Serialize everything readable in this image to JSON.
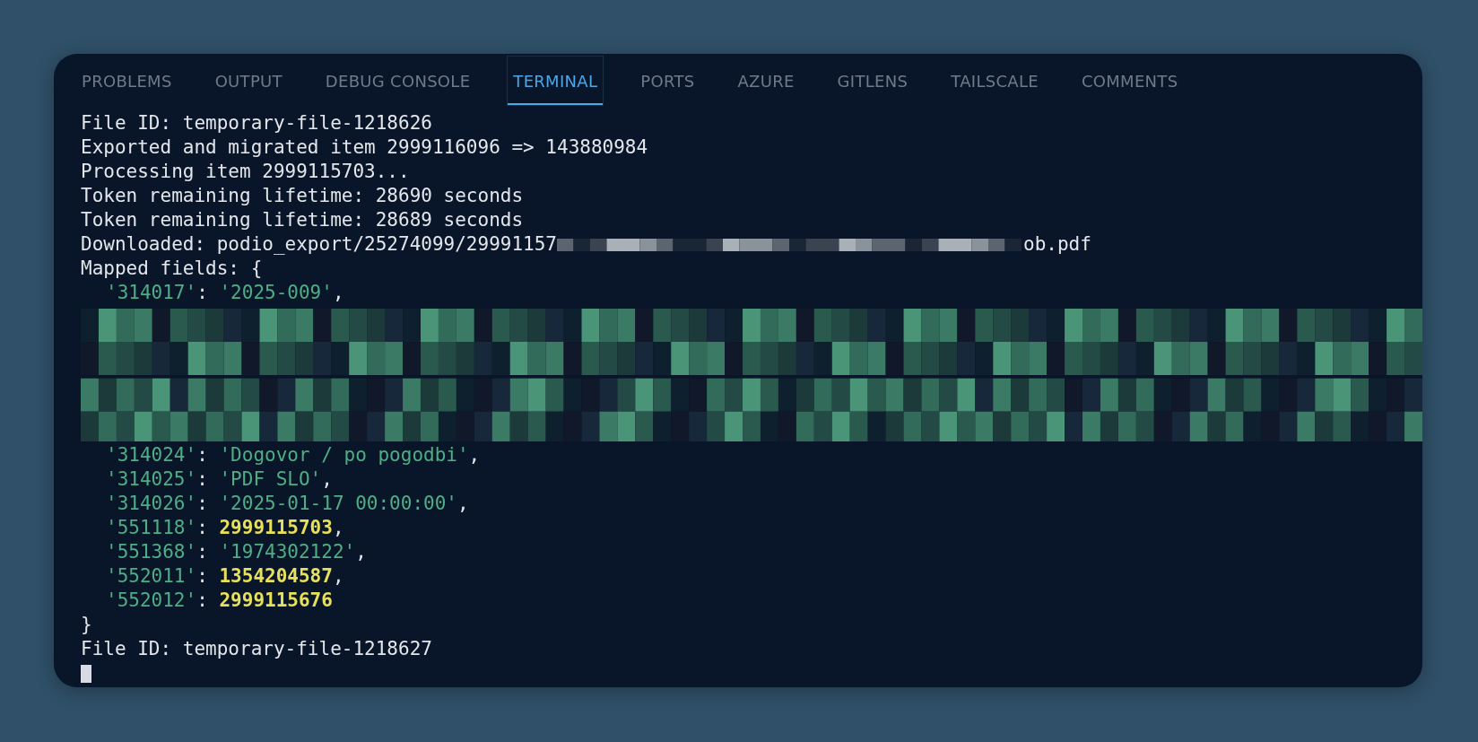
{
  "tabs": [
    {
      "label": "PROBLEMS",
      "selected": false
    },
    {
      "label": "OUTPUT",
      "selected": false
    },
    {
      "label": "DEBUG CONSOLE",
      "selected": false
    },
    {
      "label": "TERMINAL",
      "selected": true
    },
    {
      "label": "PORTS",
      "selected": false
    },
    {
      "label": "AZURE",
      "selected": false
    },
    {
      "label": "GITLENS",
      "selected": false
    },
    {
      "label": "TAILSCALE",
      "selected": false
    },
    {
      "label": "COMMENTS",
      "selected": false
    }
  ],
  "terminal": {
    "lines": [
      {
        "kind": "text",
        "parts": [
          {
            "kind": "plain",
            "text": "File ID: temporary-file-1218626"
          }
        ]
      },
      {
        "kind": "text",
        "parts": [
          {
            "kind": "plain",
            "text": "Exported and migrated item 2999116096 => 143880984"
          }
        ]
      },
      {
        "kind": "text",
        "parts": [
          {
            "kind": "plain",
            "text": "Processing item 2999115703..."
          }
        ]
      },
      {
        "kind": "text",
        "parts": [
          {
            "kind": "plain",
            "text": "Token remaining lifetime: 28690 seconds"
          }
        ]
      },
      {
        "kind": "text",
        "parts": [
          {
            "kind": "plain",
            "text": "Token remaining lifetime: 28689 seconds"
          }
        ]
      },
      {
        "kind": "text",
        "parts": [
          {
            "kind": "plain",
            "text": "Downloaded: podio_export/25274099/29991157"
          },
          {
            "kind": "redacted"
          },
          {
            "kind": "plain",
            "text": "ob.pdf"
          }
        ]
      },
      {
        "kind": "text",
        "parts": [
          {
            "kind": "plain",
            "text": "Mapped fields: {"
          }
        ]
      },
      {
        "kind": "field",
        "parts": [
          {
            "kind": "string",
            "text": "'314017'"
          },
          {
            "kind": "plain",
            "text": ": "
          },
          {
            "kind": "string",
            "text": "'2025-009'"
          },
          {
            "kind": "plain",
            "text": ","
          }
        ]
      },
      {
        "kind": "redaction"
      },
      {
        "kind": "field",
        "parts": [
          {
            "kind": "string",
            "text": "'314024'"
          },
          {
            "kind": "plain",
            "text": ": "
          },
          {
            "kind": "string",
            "text": "'Dogovor / po pogodbi'"
          },
          {
            "kind": "plain",
            "text": ","
          }
        ]
      },
      {
        "kind": "field",
        "parts": [
          {
            "kind": "string",
            "text": "'314025'"
          },
          {
            "kind": "plain",
            "text": ": "
          },
          {
            "kind": "string",
            "text": "'PDF SLO'"
          },
          {
            "kind": "plain",
            "text": ","
          }
        ]
      },
      {
        "kind": "field",
        "parts": [
          {
            "kind": "string",
            "text": "'314026'"
          },
          {
            "kind": "plain",
            "text": ": "
          },
          {
            "kind": "string",
            "text": "'2025-01-17 00:00:00'"
          },
          {
            "kind": "plain",
            "text": ","
          }
        ]
      },
      {
        "kind": "field",
        "parts": [
          {
            "kind": "string",
            "text": "'551118'"
          },
          {
            "kind": "plain",
            "text": ": "
          },
          {
            "kind": "number",
            "text": "2999115703"
          },
          {
            "kind": "plain",
            "text": ","
          }
        ]
      },
      {
        "kind": "field",
        "parts": [
          {
            "kind": "string",
            "text": "'551368'"
          },
          {
            "kind": "plain",
            "text": ": "
          },
          {
            "kind": "string",
            "text": "'1974302122'"
          },
          {
            "kind": "plain",
            "text": ","
          }
        ]
      },
      {
        "kind": "field",
        "parts": [
          {
            "kind": "string",
            "text": "'552011'"
          },
          {
            "kind": "plain",
            "text": ": "
          },
          {
            "kind": "number",
            "text": "1354204587"
          },
          {
            "kind": "plain",
            "text": ","
          }
        ]
      },
      {
        "kind": "field",
        "parts": [
          {
            "kind": "string",
            "text": "'552012'"
          },
          {
            "kind": "plain",
            "text": ": "
          },
          {
            "kind": "number",
            "text": "2999115676"
          }
        ]
      },
      {
        "kind": "text",
        "parts": [
          {
            "kind": "plain",
            "text": "}"
          }
        ]
      },
      {
        "kind": "text",
        "parts": [
          {
            "kind": "plain",
            "text": "File ID: temporary-file-1218627"
          }
        ]
      },
      {
        "kind": "cursor"
      }
    ]
  }
}
